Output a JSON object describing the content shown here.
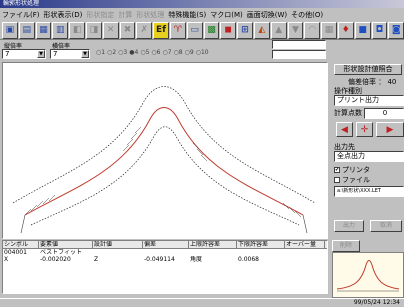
{
  "window": {
    "title": "輪郭形状処理"
  },
  "menu": {
    "items": [
      "ファイル(F)",
      "形状表示(D)"
    ],
    "disabled_items": [
      "形状指定",
      "計算",
      "形状処理"
    ],
    "more_items": [
      "特殊機能(S)",
      "マクロ(M)",
      "画面切換(W)",
      "その他(O)"
    ]
  },
  "params": {
    "scale_label": "縦倍率",
    "scale_value": "7",
    "op_label": "横倍率",
    "op_value": "7",
    "radios": [
      "1",
      "2",
      "3",
      "4",
      "5",
      "6",
      "7",
      "8",
      "9",
      "10"
    ]
  },
  "results": {
    "headers": [
      "シンボル",
      "要素値",
      "設計値",
      "偏差",
      "上限許容差",
      "下限許容差",
      "オーバー量"
    ],
    "rows": [
      [
        "004001",
        "ベストフィット",
        "",
        "",
        "",
        "",
        ""
      ],
      [
        "X",
        "-0.002020",
        "Z",
        "-0.049114",
        "角度",
        "0.0068",
        ""
      ]
    ]
  },
  "side": {
    "title": "形状設計値照合",
    "magnification": "偏差倍率 ： 40",
    "op_type_label": "操作種別",
    "op_type_value": "プリント出力",
    "calc_points_label": "計算点数",
    "calc_points_value": "0",
    "output_label": "出力先",
    "output_value": "全点出力",
    "printer_label": "プリンタ",
    "file_label": "ファイル",
    "file_path": "a:\\新形状\\XXX.LET",
    "btn_ok": "出力",
    "btn_cancel": "取消",
    "btn_delete": "削除"
  },
  "status": {
    "datetime": "99/05/24 12:34"
  },
  "colors": {
    "title_start": "#2a3a8a",
    "profile_red": "#c0392b",
    "face": "#c0c0c0"
  }
}
